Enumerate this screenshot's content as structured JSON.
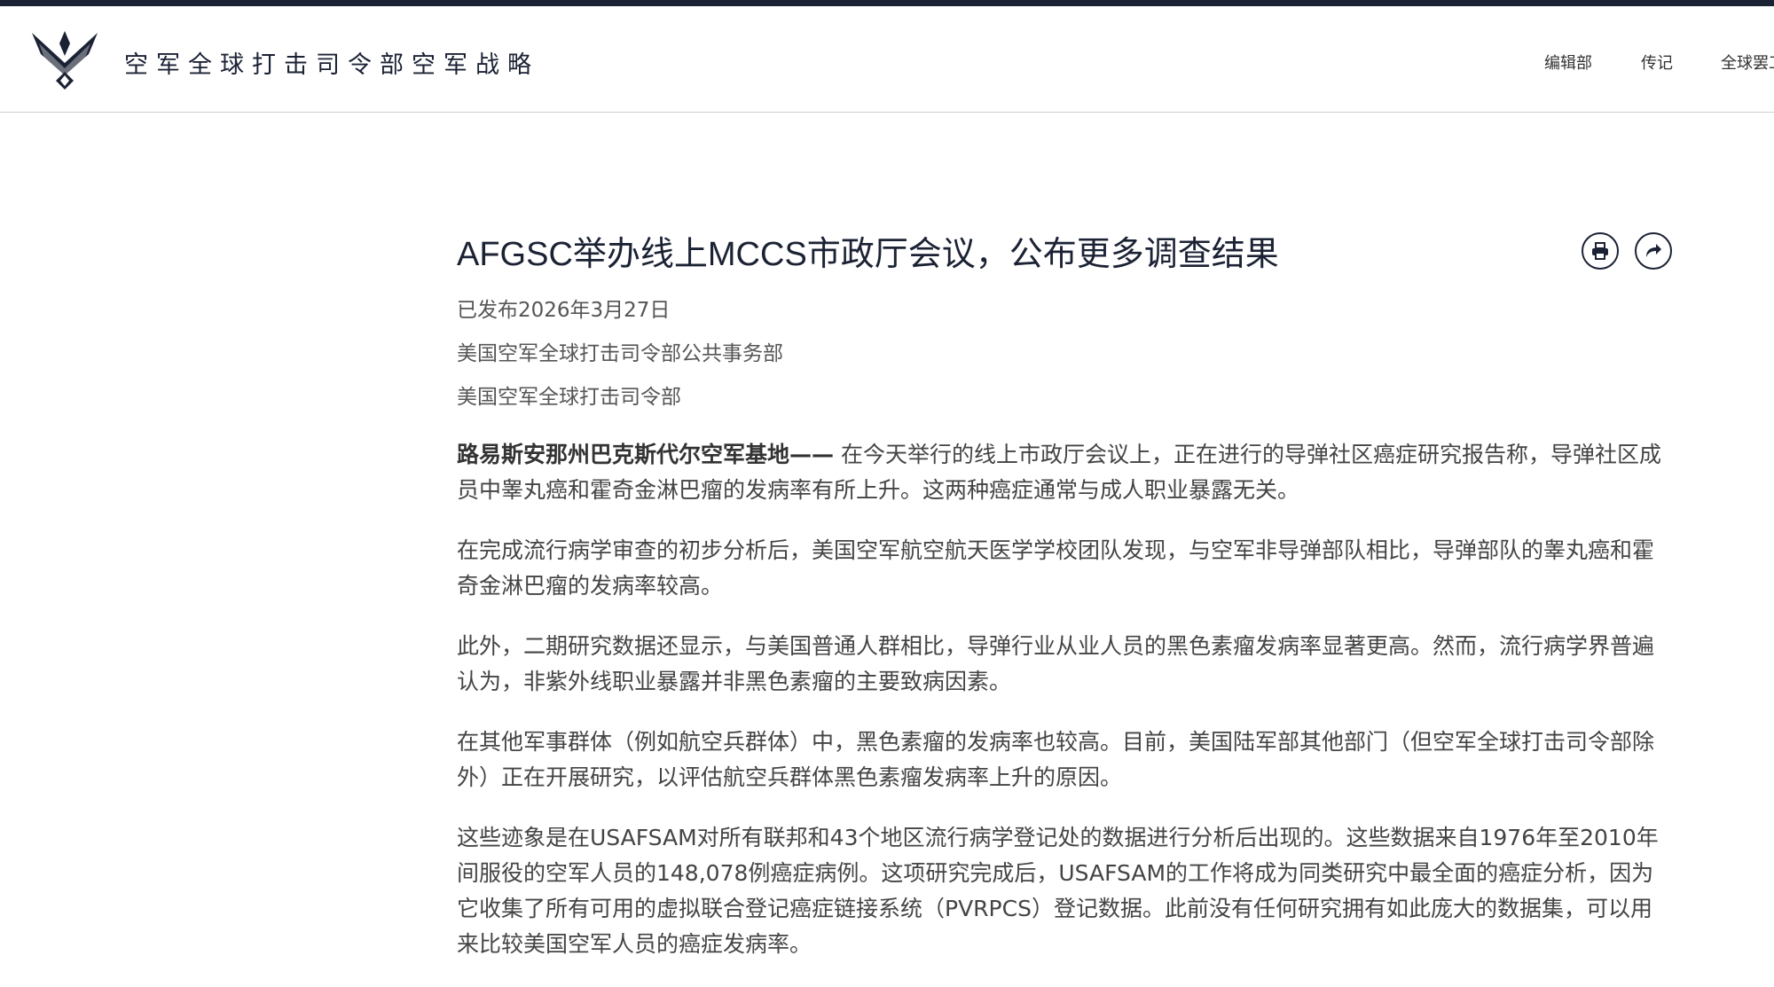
{
  "header": {
    "site_title": "空军全球打击司令部空军战略",
    "nav": [
      "编辑部",
      "传记",
      "全球罢工"
    ]
  },
  "article": {
    "title": "AFGSC举办线上MCCS市政厅会议，公布更多调查结果",
    "published": "已发布2026年3月27日",
    "author": "美国空军全球打击司令部公共事务部",
    "source": "美国空军全球打击司令部",
    "dateline": "路易斯安那州巴克斯代尔空军基地——",
    "paragraphs": [
      " 在今天举行的线上市政厅会议上，正在进行的导弹社区癌症研究报告称，导弹社区成员中睾丸癌和霍奇金淋巴瘤的发病率有所上升。这两种癌症通常与成人职业暴露无关。",
      "在完成流行病学审查的初步分析后，美国空军航空航天医学学校团队发现，与空军非导弹部队相比，导弹部队的睾丸癌和霍奇金淋巴瘤的发病率较高。",
      "此外，二期研究数据还显示，与美国普通人群相比，导弹行业从业人员的黑色素瘤发病率显著更高。然而，流行病学界普遍认为，非紫外线职业暴露并非黑色素瘤的主要致病因素。",
      "在其他军事群体（例如航空兵群体）中，黑色素瘤的发病率也较高。目前，美国陆军部其他部门（但空军全球打击司令部除外）正在开展研究，以评估航空兵群体黑色素瘤发病率上升的原因。",
      "这些迹象是在USAFSAM对所有联邦和43个地区流行病学登记处的数据进行分析后出现的。这些数据来自1976年至2010年间服役的空军人员的148,078例癌症病例。这项研究完成后，USAFSAM的工作将成为同类研究中最全面的癌症分析，因为它收集了所有可用的虚拟联合登记癌症链接系统（PVRPCS）登记数据。此前没有任何研究拥有如此庞大的数据集，可以用来比较美国空军人员的癌症发病率。"
    ]
  },
  "icons": [
    "print-icon",
    "share-icon",
    "air-force-logo-icon"
  ],
  "colors": {
    "navy": "#1b2234",
    "text": "#444444"
  }
}
